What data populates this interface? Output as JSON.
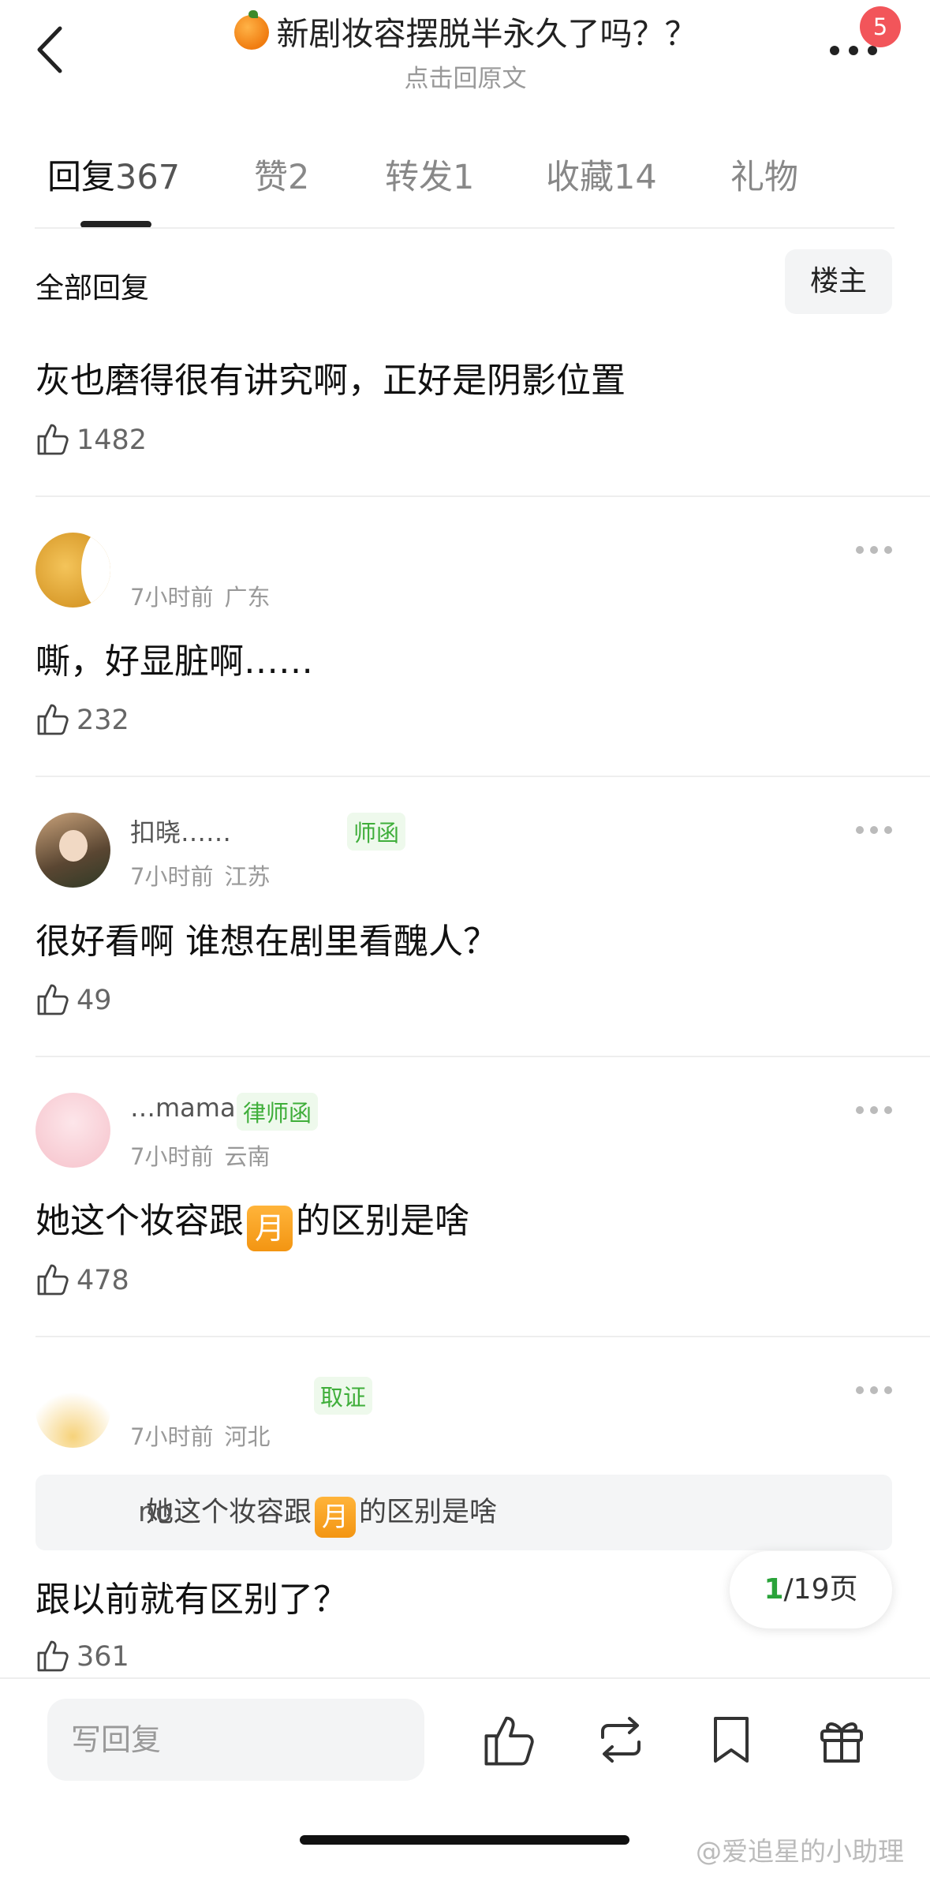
{
  "header": {
    "title": "新剧妆容摆脱半永久了吗？？",
    "subtitle": "点击回原文",
    "notification_count": "5"
  },
  "tabs": [
    {
      "label": "回复",
      "count": "367"
    },
    {
      "label": "赞",
      "count": "2"
    },
    {
      "label": "转发",
      "count": "1"
    },
    {
      "label": "收藏",
      "count": "14"
    },
    {
      "label": "礼物",
      "count": ""
    }
  ],
  "filter": {
    "label": "全部回复",
    "button": "楼主"
  },
  "top_comment": {
    "text": "灰也磨得很有讲究啊，正好是阴影位置",
    "likes": "1482"
  },
  "comments": [
    {
      "time": "7小时前",
      "region": "广东",
      "text": "嘶，好显脏啊……",
      "likes": "232"
    },
    {
      "username": "扣晓……",
      "tag": "师函",
      "time": "7小时前",
      "region": "江苏",
      "text": "很好看啊 谁想在剧里看醜人？",
      "likes": "49"
    },
    {
      "username": "…mama…",
      "tag": "律师函",
      "time": "7小时前",
      "region": "云南",
      "text_before": "她这个妆容跟",
      "emoji": "月",
      "text_after": "的区别是啥",
      "likes": "478"
    },
    {
      "tag": "取证",
      "time": "7小时前",
      "region": "河北",
      "quote_user": "no",
      "quote_before": "她这个妆容跟",
      "quote_emoji": "月",
      "quote_after": "的区别是啥",
      "text": "跟以前就有区别了？",
      "likes": "361"
    }
  ],
  "pagination": {
    "current": "1",
    "total_text": "/19页"
  },
  "bottom_bar": {
    "reply_placeholder": "写回复",
    "icons": [
      "like-icon",
      "repost-icon",
      "bookmark-icon",
      "gift-icon"
    ]
  },
  "watermark": "@爱追星的小助理"
}
